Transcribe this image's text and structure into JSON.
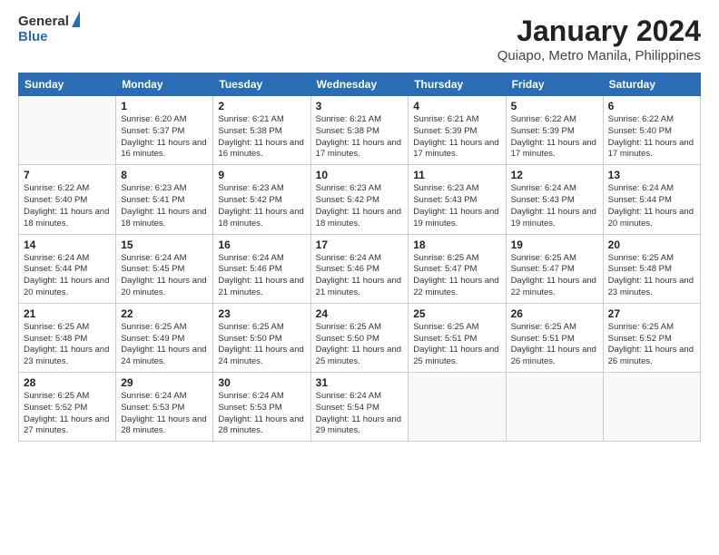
{
  "header": {
    "logo_general": "General",
    "logo_blue": "Blue",
    "title": "January 2024",
    "subtitle": "Quiapo, Metro Manila, Philippines"
  },
  "columns": [
    "Sunday",
    "Monday",
    "Tuesday",
    "Wednesday",
    "Thursday",
    "Friday",
    "Saturday"
  ],
  "weeks": [
    [
      {
        "day": "",
        "info": ""
      },
      {
        "day": "1",
        "info": "Sunrise: 6:20 AM\nSunset: 5:37 PM\nDaylight: 11 hours\nand 16 minutes."
      },
      {
        "day": "2",
        "info": "Sunrise: 6:21 AM\nSunset: 5:38 PM\nDaylight: 11 hours\nand 16 minutes."
      },
      {
        "day": "3",
        "info": "Sunrise: 6:21 AM\nSunset: 5:38 PM\nDaylight: 11 hours\nand 17 minutes."
      },
      {
        "day": "4",
        "info": "Sunrise: 6:21 AM\nSunset: 5:39 PM\nDaylight: 11 hours\nand 17 minutes."
      },
      {
        "day": "5",
        "info": "Sunrise: 6:22 AM\nSunset: 5:39 PM\nDaylight: 11 hours\nand 17 minutes."
      },
      {
        "day": "6",
        "info": "Sunrise: 6:22 AM\nSunset: 5:40 PM\nDaylight: 11 hours\nand 17 minutes."
      }
    ],
    [
      {
        "day": "7",
        "info": "Sunrise: 6:22 AM\nSunset: 5:40 PM\nDaylight: 11 hours\nand 18 minutes."
      },
      {
        "day": "8",
        "info": "Sunrise: 6:23 AM\nSunset: 5:41 PM\nDaylight: 11 hours\nand 18 minutes."
      },
      {
        "day": "9",
        "info": "Sunrise: 6:23 AM\nSunset: 5:42 PM\nDaylight: 11 hours\nand 18 minutes."
      },
      {
        "day": "10",
        "info": "Sunrise: 6:23 AM\nSunset: 5:42 PM\nDaylight: 11 hours\nand 18 minutes."
      },
      {
        "day": "11",
        "info": "Sunrise: 6:23 AM\nSunset: 5:43 PM\nDaylight: 11 hours\nand 19 minutes."
      },
      {
        "day": "12",
        "info": "Sunrise: 6:24 AM\nSunset: 5:43 PM\nDaylight: 11 hours\nand 19 minutes."
      },
      {
        "day": "13",
        "info": "Sunrise: 6:24 AM\nSunset: 5:44 PM\nDaylight: 11 hours\nand 20 minutes."
      }
    ],
    [
      {
        "day": "14",
        "info": "Sunrise: 6:24 AM\nSunset: 5:44 PM\nDaylight: 11 hours\nand 20 minutes."
      },
      {
        "day": "15",
        "info": "Sunrise: 6:24 AM\nSunset: 5:45 PM\nDaylight: 11 hours\nand 20 minutes."
      },
      {
        "day": "16",
        "info": "Sunrise: 6:24 AM\nSunset: 5:46 PM\nDaylight: 11 hours\nand 21 minutes."
      },
      {
        "day": "17",
        "info": "Sunrise: 6:24 AM\nSunset: 5:46 PM\nDaylight: 11 hours\nand 21 minutes."
      },
      {
        "day": "18",
        "info": "Sunrise: 6:25 AM\nSunset: 5:47 PM\nDaylight: 11 hours\nand 22 minutes."
      },
      {
        "day": "19",
        "info": "Sunrise: 6:25 AM\nSunset: 5:47 PM\nDaylight: 11 hours\nand 22 minutes."
      },
      {
        "day": "20",
        "info": "Sunrise: 6:25 AM\nSunset: 5:48 PM\nDaylight: 11 hours\nand 23 minutes."
      }
    ],
    [
      {
        "day": "21",
        "info": "Sunrise: 6:25 AM\nSunset: 5:48 PM\nDaylight: 11 hours\nand 23 minutes."
      },
      {
        "day": "22",
        "info": "Sunrise: 6:25 AM\nSunset: 5:49 PM\nDaylight: 11 hours\nand 24 minutes."
      },
      {
        "day": "23",
        "info": "Sunrise: 6:25 AM\nSunset: 5:50 PM\nDaylight: 11 hours\nand 24 minutes."
      },
      {
        "day": "24",
        "info": "Sunrise: 6:25 AM\nSunset: 5:50 PM\nDaylight: 11 hours\nand 25 minutes."
      },
      {
        "day": "25",
        "info": "Sunrise: 6:25 AM\nSunset: 5:51 PM\nDaylight: 11 hours\nand 25 minutes."
      },
      {
        "day": "26",
        "info": "Sunrise: 6:25 AM\nSunset: 5:51 PM\nDaylight: 11 hours\nand 26 minutes."
      },
      {
        "day": "27",
        "info": "Sunrise: 6:25 AM\nSunset: 5:52 PM\nDaylight: 11 hours\nand 26 minutes."
      }
    ],
    [
      {
        "day": "28",
        "info": "Sunrise: 6:25 AM\nSunset: 5:52 PM\nDaylight: 11 hours\nand 27 minutes."
      },
      {
        "day": "29",
        "info": "Sunrise: 6:24 AM\nSunset: 5:53 PM\nDaylight: 11 hours\nand 28 minutes."
      },
      {
        "day": "30",
        "info": "Sunrise: 6:24 AM\nSunset: 5:53 PM\nDaylight: 11 hours\nand 28 minutes."
      },
      {
        "day": "31",
        "info": "Sunrise: 6:24 AM\nSunset: 5:54 PM\nDaylight: 11 hours\nand 29 minutes."
      },
      {
        "day": "",
        "info": ""
      },
      {
        "day": "",
        "info": ""
      },
      {
        "day": "",
        "info": ""
      }
    ]
  ]
}
